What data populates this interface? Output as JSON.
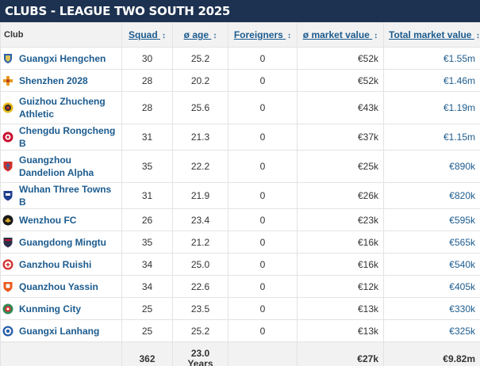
{
  "title": "CLUBS - LEAGUE TWO SOUTH 2025",
  "columns": {
    "club": "Club",
    "squad": "Squad",
    "age": "ø age",
    "foreigners": "Foreigners",
    "market_value": "ø market value",
    "total_value": "Total market value",
    "sort_icon": "↕"
  },
  "rows": [
    {
      "name": "Guangxi Hengchen",
      "squad": "30",
      "age": "25.2",
      "foreigners": "0",
      "mv": "€52k",
      "total": "€1.55m",
      "crest": "shield-blue-crest"
    },
    {
      "name": "Shenzhen 2028",
      "squad": "28",
      "age": "20.2",
      "foreigners": "0",
      "mv": "€52k",
      "total": "€1.46m",
      "crest": "orange-cross-crest"
    },
    {
      "name": "Guizhou Zhucheng Athletic",
      "squad": "28",
      "age": "25.6",
      "foreigners": "0",
      "mv": "€43k",
      "total": "€1.19m",
      "crest": "yellow-round-crest"
    },
    {
      "name": "Chengdu Rongcheng B",
      "squad": "31",
      "age": "21.3",
      "foreigners": "0",
      "mv": "€37k",
      "total": "€1.15m",
      "crest": "red-round-crest"
    },
    {
      "name": "Guangzhou Dandelion Alpha",
      "squad": "35",
      "age": "22.2",
      "foreigners": "0",
      "mv": "€25k",
      "total": "€890k",
      "crest": "red-shield-crest"
    },
    {
      "name": "Wuhan Three Towns B",
      "squad": "31",
      "age": "21.9",
      "foreigners": "0",
      "mv": "€26k",
      "total": "€820k",
      "crest": "navy-shield-crest"
    },
    {
      "name": "Wenzhou FC",
      "squad": "26",
      "age": "23.4",
      "foreigners": "0",
      "mv": "€23k",
      "total": "€595k",
      "crest": "black-gold-crest"
    },
    {
      "name": "Guangdong Mingtu",
      "squad": "35",
      "age": "21.2",
      "foreigners": "0",
      "mv": "€16k",
      "total": "€565k",
      "crest": "dark-shield-crest"
    },
    {
      "name": "Ganzhou Ruishi",
      "squad": "34",
      "age": "25.0",
      "foreigners": "0",
      "mv": "€16k",
      "total": "€540k",
      "crest": "red-ring-crest"
    },
    {
      "name": "Quanzhou Yassin",
      "squad": "34",
      "age": "22.6",
      "foreigners": "0",
      "mv": "€12k",
      "total": "€405k",
      "crest": "orange-shield-crest"
    },
    {
      "name": "Kunming City",
      "squad": "25",
      "age": "23.5",
      "foreigners": "0",
      "mv": "€13k",
      "total": "€330k",
      "crest": "green-red-crest"
    },
    {
      "name": "Guangxi Lanhang",
      "squad": "25",
      "age": "25.2",
      "foreigners": "0",
      "mv": "€13k",
      "total": "€325k",
      "crest": "blue-ring-crest"
    }
  ],
  "totals": {
    "squad": "362",
    "age": "23.0",
    "age_unit": "Years",
    "mv": "€27k",
    "total": "€9.82m"
  },
  "colors": {
    "title_bar": "#1d3150",
    "link": "#1c5b8e",
    "header_bg": "#f2f2f2"
  }
}
